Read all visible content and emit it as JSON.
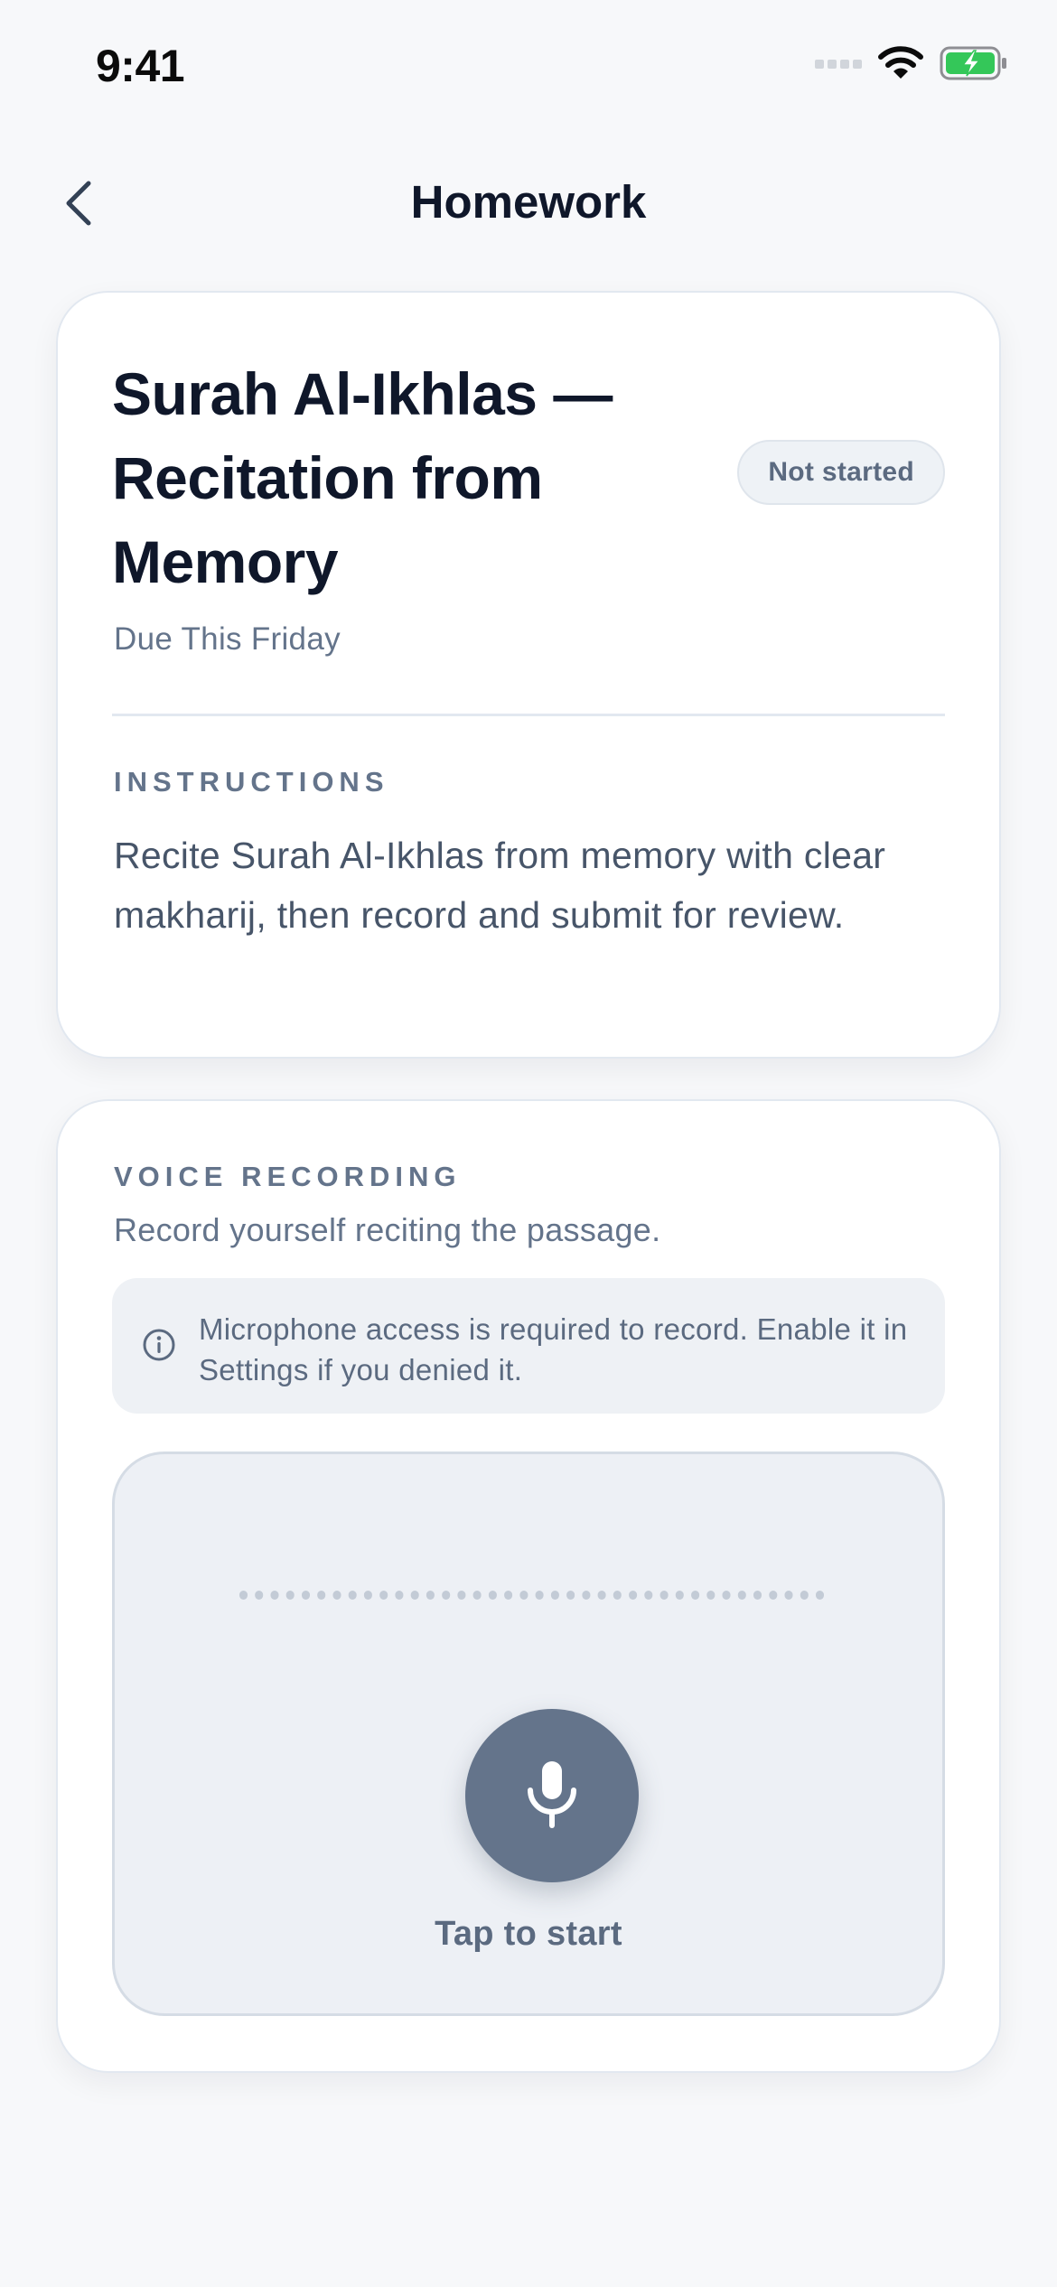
{
  "status_bar": {
    "time": "9:41"
  },
  "nav": {
    "title": "Homework",
    "back_icon": "chevron-left-icon"
  },
  "assignment": {
    "title": "Surah Al-Ikhlas — Recitation from Memory",
    "status": "Not started",
    "due": "Due This Friday",
    "instructions_label": "INSTRUCTIONS",
    "instructions": "Recite Surah Al-Ikhlas from memory with clear makharij, then record and submit for review."
  },
  "recording": {
    "label": "VOICE RECORDING",
    "subtitle": "Record yourself reciting the passage.",
    "notice": "Microphone access is required to record. Enable it in Settings if you denied it.",
    "notice_icon": "info-icon",
    "mic_icon": "microphone-icon",
    "button_label": "Tap to start"
  },
  "colors": {
    "accent": "#64748b",
    "battery": "#34c759",
    "title": "#0f172a"
  }
}
